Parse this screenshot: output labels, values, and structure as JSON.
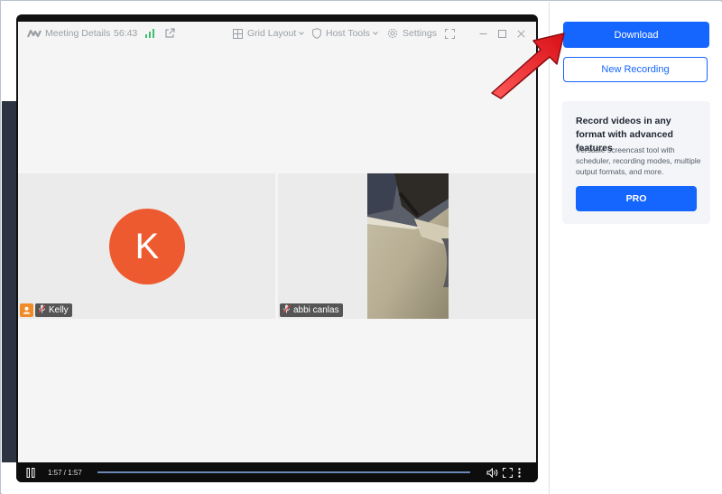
{
  "meeting_window": {
    "title": "Meeting Details",
    "duration": "56:43",
    "layout_label": "Grid Layout",
    "host_tools_label": "Host Tools",
    "settings_label": "Settings"
  },
  "participants": [
    {
      "name": "Kelly",
      "initial": "K",
      "avatar_color": "#ed5a2f",
      "is_host": true,
      "muted": true
    },
    {
      "name": "abbi canlas",
      "is_host": false,
      "muted": true
    }
  ],
  "player": {
    "time": "1:57 / 1:57",
    "progress": 1.0
  },
  "sidebar": {
    "download_label": "Download",
    "new_recording_label": "New Recording",
    "promo": {
      "title": "Record videos in any format with advanced features",
      "description": "Versatile screencast tool with scheduler, recording modes, multiple output formats, and more.",
      "button_label": "PRO"
    }
  },
  "colors": {
    "accent": "#1565ff",
    "arrow": "#e8141b"
  }
}
